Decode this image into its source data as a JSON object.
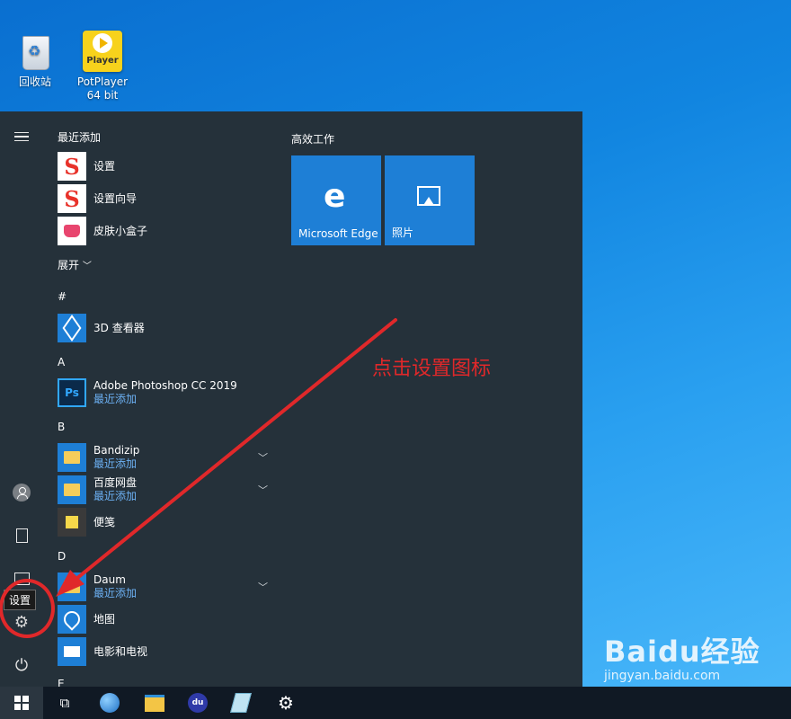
{
  "desktop": {
    "icons": [
      {
        "label": "回收站"
      },
      {
        "label": "PotPlayer 64 bit",
        "icon_text": "Player"
      }
    ]
  },
  "start_menu": {
    "recently_added_header": "最近添加",
    "recent": [
      {
        "name": "设置",
        "icon": "sogou-icon"
      },
      {
        "name": "设置向导",
        "icon": "sogou-icon"
      },
      {
        "name": "皮肤小盒子",
        "icon": "skin-box-icon"
      }
    ],
    "expand_label": "展开",
    "sections": {
      "hash": "#",
      "a": "A",
      "b": "B",
      "d": "D",
      "e": "E"
    },
    "apps": {
      "viewer3d": {
        "name": "3D 查看器"
      },
      "photoshop": {
        "name": "Adobe Photoshop CC 2019",
        "sub": "最近添加",
        "icon_text": "Ps"
      },
      "bandizip": {
        "name": "Bandizip",
        "sub": "最近添加"
      },
      "baiduwangpan": {
        "name": "百度网盘",
        "sub": "最近添加"
      },
      "sticky": {
        "name": "便笺"
      },
      "daum": {
        "name": "Daum",
        "sub": "最近添加"
      },
      "maps": {
        "name": "地图"
      },
      "movies": {
        "name": "电影和电视"
      }
    },
    "tiles_header": "高效工作",
    "tiles": [
      {
        "label": "Microsoft Edge",
        "glyph": "e"
      },
      {
        "label": "照片"
      }
    ],
    "tooltip": "设置"
  },
  "annotation": {
    "text": "点击设置图标",
    "color": "#e0282a"
  },
  "watermark": {
    "logo": "Baidu经验",
    "url": "jingyan.baidu.com"
  },
  "taskbar": {
    "items": [
      "start-icon",
      "task-view-icon",
      "browser-globe-icon",
      "file-explorer-icon",
      "baidu-icon",
      "notepad-icon",
      "settings-gear-icon"
    ],
    "baidu_text": "du"
  },
  "colors": {
    "accent": "#1e7fd6",
    "menu_bg": "#25313a",
    "taskbar_bg": "#101924"
  }
}
